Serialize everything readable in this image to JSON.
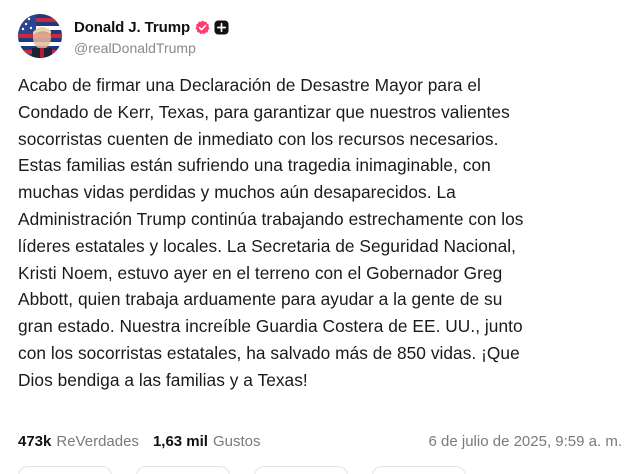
{
  "author": {
    "display_name": "Donald J. Trump",
    "handle": "@realDonaldTrump",
    "verified_color": "#ff3b6b",
    "avatar_icon": "flag-portrait-avatar",
    "badge_icon": "plus-badge-icon"
  },
  "post": {
    "text": "Acabo de firmar una Declaración de Desastre Mayor para el\nCondado de Kerr, Texas, para garantizar que nuestros valientes\nsocorristas cuenten de inmediato con los recursos necesarios.\nEstas familias están sufriendo una tragedia inimaginable, con\nmuchas vidas perdidas y muchos aún desaparecidos. La\nAdministración Trump continúa trabajando estrechamente con los\nlíderes estatales y locales. La Secretaria de Seguridad Nacional,\nKristi Noem, estuvo ayer en el terreno con el Gobernador Greg\nAbbott, quien trabaja arduamente para ayudar a la gente de su\ngran estado. Nuestra increíble Guardia Costera de EE. UU., junto\ncon los socorristas estatales, ha salvado más de 850 vidas. ¡Que\nDios bendiga a las familias y a Texas!"
  },
  "stats": {
    "reposts_value": "473k",
    "reposts_label": "ReVerdades",
    "likes_value": "1,63 mil",
    "likes_label": "Gustos",
    "timestamp": "6 de julio de 2025, 9:59 a. m."
  }
}
